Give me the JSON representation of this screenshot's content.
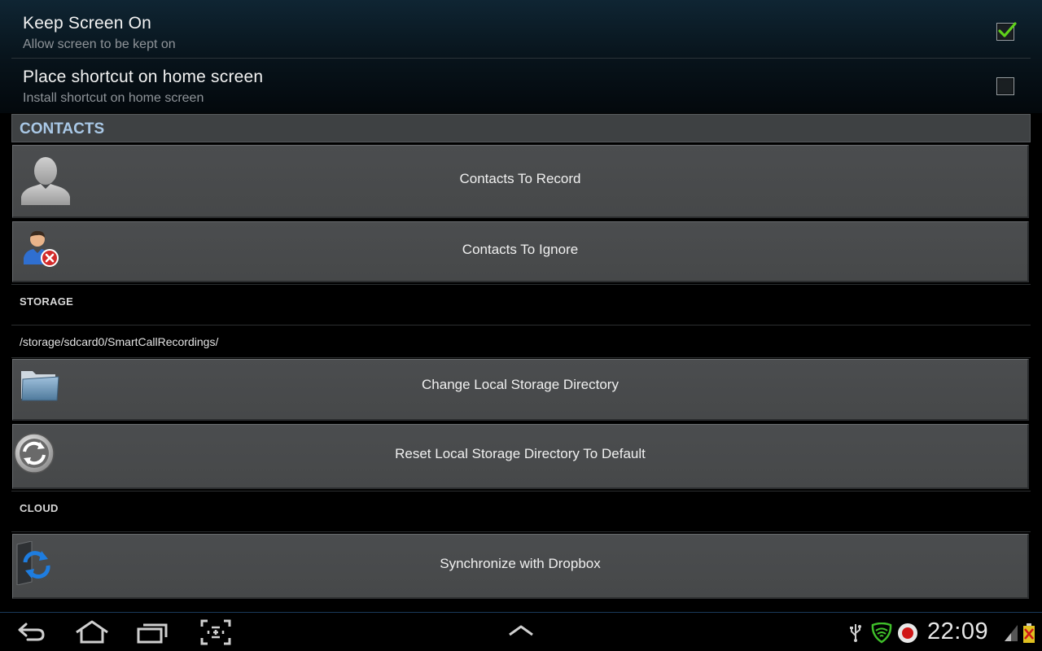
{
  "preferences": [
    {
      "title": "Keep Screen On",
      "subtitle": "Allow screen to be kept on",
      "checked": true
    },
    {
      "title": "Place shortcut on home screen",
      "subtitle": "Install shortcut on home screen",
      "checked": false
    }
  ],
  "contacts": {
    "header": "CONTACTS",
    "record_label": "Contacts To Record",
    "ignore_label": "Contacts To Ignore"
  },
  "storage": {
    "header": "STORAGE",
    "path": "/storage/sdcard0/SmartCallRecordings/",
    "change_label": "Change Local Storage Directory",
    "reset_label": "Reset Local Storage Directory To Default"
  },
  "cloud": {
    "header": "CLOUD",
    "dropbox_label": "Synchronize with Dropbox"
  },
  "status_bar": {
    "time": "22:09",
    "icons": [
      "usb-icon",
      "wifi-icon",
      "record-icon",
      "signal-icon",
      "battery-icon"
    ]
  },
  "nav_bar": {
    "buttons": [
      "back-icon",
      "home-icon",
      "recent-apps-icon",
      "screenshot-icon",
      "chevron-up-icon"
    ]
  },
  "colors": {
    "section_header_text": "#a9c8e6",
    "check_green": "#5fd11a",
    "button_bg": "#4a4c4e"
  }
}
